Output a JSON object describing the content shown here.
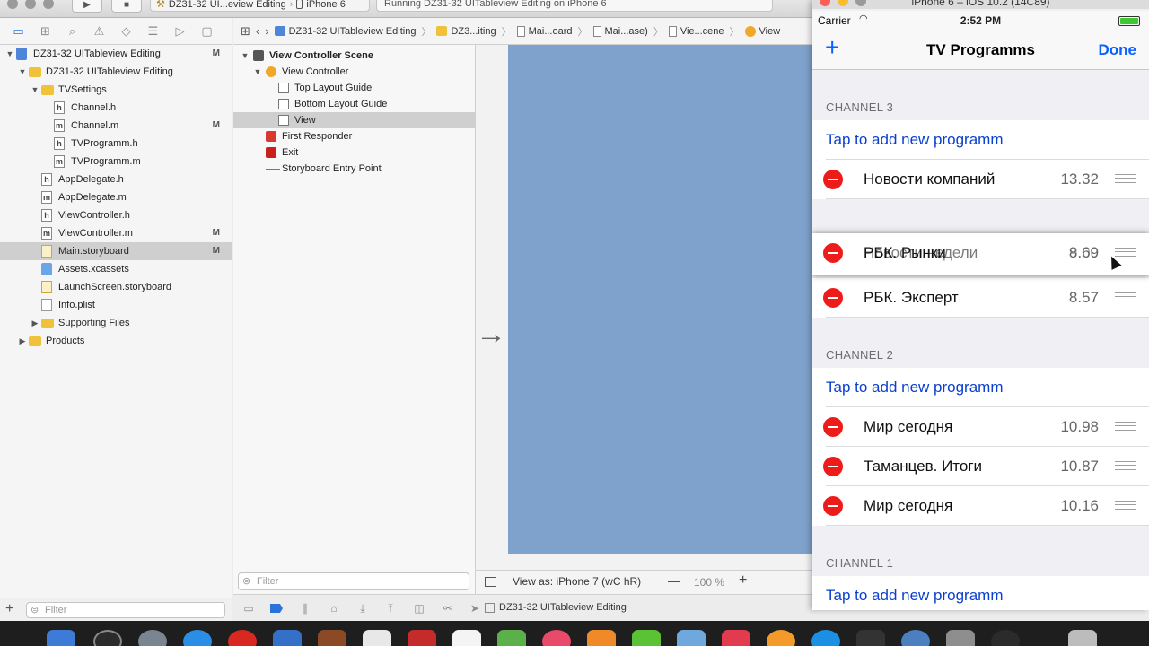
{
  "toolbar": {
    "scheme": "DZ31-32 UI...eview Editing",
    "device": "iPhone 6",
    "activity": "Running DZ31-32 UITableview Editing on iPhone 6"
  },
  "navigator": {
    "filter_placeholder": "Filter",
    "tree": [
      {
        "label": "DZ31-32 UITableview Editing",
        "badge": "M",
        "indent": 0,
        "icon": "proj",
        "disclosure": "▼"
      },
      {
        "label": "DZ31-32 UITableview Editing",
        "badge": "",
        "indent": 1,
        "icon": "folder",
        "disclosure": "▼"
      },
      {
        "label": "TVSettings",
        "badge": "",
        "indent": 2,
        "icon": "folder",
        "disclosure": "▼"
      },
      {
        "label": "Channel.h",
        "badge": "",
        "indent": 3,
        "icon": "h",
        "disclosure": ""
      },
      {
        "label": "Channel.m",
        "badge": "M",
        "indent": 3,
        "icon": "m",
        "disclosure": ""
      },
      {
        "label": "TVProgramm.h",
        "badge": "",
        "indent": 3,
        "icon": "h",
        "disclosure": ""
      },
      {
        "label": "TVProgramm.m",
        "badge": "",
        "indent": 3,
        "icon": "m",
        "disclosure": ""
      },
      {
        "label": "AppDelegate.h",
        "badge": "",
        "indent": 2,
        "icon": "h",
        "disclosure": ""
      },
      {
        "label": "AppDelegate.m",
        "badge": "",
        "indent": 2,
        "icon": "m",
        "disclosure": ""
      },
      {
        "label": "ViewController.h",
        "badge": "",
        "indent": 2,
        "icon": "h",
        "disclosure": ""
      },
      {
        "label": "ViewController.m",
        "badge": "M",
        "indent": 2,
        "icon": "m",
        "disclosure": ""
      },
      {
        "label": "Main.storyboard",
        "badge": "M",
        "indent": 2,
        "icon": "sb",
        "disclosure": "",
        "selected": true
      },
      {
        "label": "Assets.xcassets",
        "badge": "",
        "indent": 2,
        "icon": "asset",
        "disclosure": ""
      },
      {
        "label": "LaunchScreen.storyboard",
        "badge": "",
        "indent": 2,
        "icon": "sb",
        "disclosure": ""
      },
      {
        "label": "Info.plist",
        "badge": "",
        "indent": 2,
        "icon": "plist",
        "disclosure": ""
      },
      {
        "label": "Supporting Files",
        "badge": "",
        "indent": 2,
        "icon": "folder",
        "disclosure": "▶"
      },
      {
        "label": "Products",
        "badge": "",
        "indent": 1,
        "icon": "folder",
        "disclosure": "▶"
      }
    ]
  },
  "jump_bar": {
    "crumbs": [
      {
        "label": "DZ31-32 UITableview Editing",
        "icon": "proj"
      },
      {
        "label": "DZ3...iting",
        "icon": "folder"
      },
      {
        "label": "Mai...oard",
        "icon": "file"
      },
      {
        "label": "Mai...ase)",
        "icon": "file"
      },
      {
        "label": "Vie...cene",
        "icon": "file"
      },
      {
        "label": "View",
        "icon": "vc"
      }
    ]
  },
  "outline": {
    "filter_placeholder": "Filter",
    "rows": [
      {
        "label": "View Controller Scene",
        "indent": 0,
        "icon": "scene",
        "disclosure": "▼",
        "bold": true
      },
      {
        "label": "View Controller",
        "indent": 1,
        "icon": "vc",
        "disclosure": "▼"
      },
      {
        "label": "Top Layout Guide",
        "indent": 2,
        "icon": "guide",
        "disclosure": ""
      },
      {
        "label": "Bottom Layout Guide",
        "indent": 2,
        "icon": "guide",
        "disclosure": ""
      },
      {
        "label": "View",
        "indent": 2,
        "icon": "guide",
        "disclosure": "",
        "selected": true
      },
      {
        "label": "First Responder",
        "indent": 1,
        "icon": "responder",
        "disclosure": ""
      },
      {
        "label": "Exit",
        "indent": 1,
        "icon": "exit",
        "disclosure": ""
      },
      {
        "label": "Storyboard Entry Point",
        "indent": 1,
        "icon": "entry",
        "disclosure": ""
      }
    ]
  },
  "canvas": {
    "view_as": "View as: iPhone 7 (wC hR)",
    "zoom": "100 %",
    "minus": "—",
    "plus": "+"
  },
  "debug_bar": {
    "target": "DZ31-32 UITableview Editing"
  },
  "simulator": {
    "window_title": "iPhone 6 – iOS 10.2 (14C89)",
    "status": {
      "carrier": "Carrier",
      "time": "2:52 PM"
    },
    "nav": {
      "add": "+",
      "title": "TV Programms",
      "done": "Done"
    },
    "add_label": "Tap to add new programm",
    "channels": [
      {
        "header": "CHANNEL 3",
        "programs": [
          {
            "name": "Новости компаний",
            "time": "13.32"
          },
          {
            "name": "РБК. Эксперт",
            "time": "8.57"
          }
        ]
      },
      {
        "header": "CHANNEL 2",
        "programs": [
          {
            "name": "Мир сегодня",
            "time": "10.98"
          },
          {
            "name": "Таманцев. Итоги",
            "time": "10.87"
          },
          {
            "name": "Мир сегодня",
            "time": "10.16"
          }
        ]
      },
      {
        "header": "CHANNEL 1",
        "programs": []
      }
    ],
    "dragging": {
      "name_a": "РБК. Рынки",
      "name_b": "Новости недели",
      "time_a": "8.69",
      "time_b": "9.00"
    }
  },
  "colors": {
    "accent": "#0a60ff",
    "delete": "#ee1b1b",
    "canvas_view": "#7ea2cc"
  }
}
